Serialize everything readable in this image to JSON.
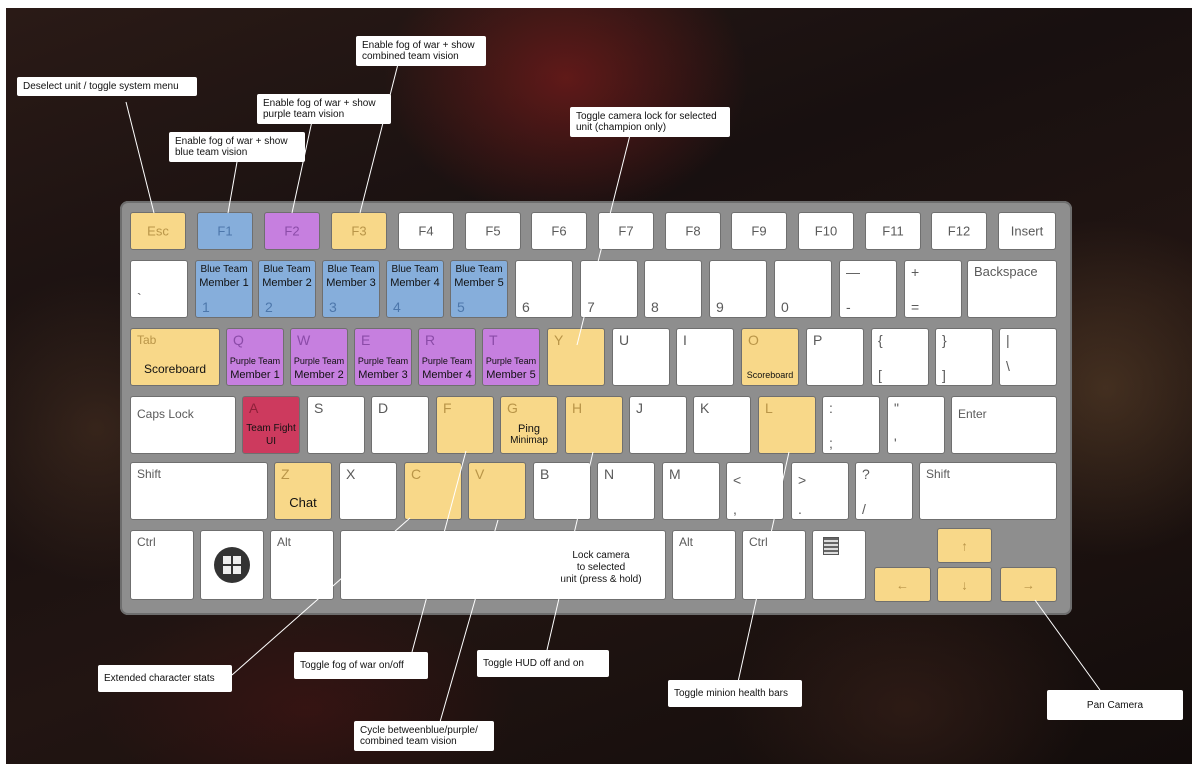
{
  "keys": {
    "esc": "Esc",
    "f1": "F1",
    "f2": "F2",
    "f3": "F3",
    "f4": "F4",
    "f5": "F5",
    "f6": "F6",
    "f7": "F7",
    "f8": "F8",
    "f9": "F9",
    "f10": "F10",
    "f11": "F11",
    "f12": "F12",
    "insert": "Insert",
    "backtick": "`",
    "n1": "1",
    "n2": "2",
    "n3": "3",
    "n4": "4",
    "n5": "5",
    "n6": "6",
    "n7": "7",
    "n8": "8",
    "n9": "9",
    "n0": "0",
    "minus_top": "—",
    "minus_bottom": "-",
    "plus_top": "+",
    "plus_bottom": "=",
    "backspace": "Backspace",
    "tab": "Tab",
    "q": "Q",
    "w": "W",
    "e": "E",
    "r": "R",
    "t": "T",
    "y": "Y",
    "u": "U",
    "i": "I",
    "o": "O",
    "p": "P",
    "brace_open_top": "{",
    "brace_open_bottom": "[",
    "brace_close_top": "}",
    "brace_close_bottom": "]",
    "pipe_top": "|",
    "pipe_bottom": "\\",
    "caps": "Caps Lock",
    "a": "A",
    "s": "S",
    "d": "D",
    "f": "F",
    "g": "G",
    "h": "H",
    "j": "J",
    "k": "K",
    "l": "L",
    "colon_top": ":",
    "colon_bottom": ";",
    "quote_top": "\"",
    "quote_bottom": "'",
    "enter": "Enter",
    "shift_left": "Shift",
    "z": "Z",
    "x": "X",
    "c": "C",
    "v": "V",
    "b": "B",
    "n": "N",
    "m": "M",
    "lt_top": "<",
    "lt_bottom": ",",
    "gt_top": ">",
    "gt_bottom": ".",
    "q_top": "?",
    "q_bottom": "/",
    "shift_right": "Shift",
    "ctrl_left": "Ctrl",
    "alt_left": "Alt",
    "alt_right": "Alt",
    "ctrl_right": "Ctrl",
    "up": "↑",
    "left": "←",
    "down": "↓",
    "right": "→"
  },
  "actions": {
    "blue1": [
      "Blue Team",
      "Member 1"
    ],
    "blue2": [
      "Blue Team",
      "Member 2"
    ],
    "blue3": [
      "Blue Team",
      "Member 3"
    ],
    "blue4": [
      "Blue Team",
      "Member 4"
    ],
    "blue5": [
      "Blue Team",
      "Member 5"
    ],
    "tab": "Scoreboard",
    "purple1": [
      "Purple Team",
      "Member 1"
    ],
    "purple2": [
      "Purple Team",
      "Member 2"
    ],
    "purple3": [
      "Purple Team",
      "Member 3"
    ],
    "purple4": [
      "Purple Team",
      "Member 4"
    ],
    "purple5": [
      "Purple Team",
      "Member 5"
    ],
    "o": "Scoreboard",
    "a": [
      "Team Fight",
      "UI"
    ],
    "g": [
      "Ping",
      "Minimap"
    ],
    "z": "Chat",
    "space": [
      "Lock camera",
      "to selected",
      "unit (press & hold)"
    ]
  },
  "callouts": {
    "esc": "Deselect unit / toggle system menu",
    "f1": "Enable fog of war + show blue team vision",
    "f2": "Enable fog of war + show purple team vision",
    "f3": "Enable fog of war + show combined team vision",
    "y": "Toggle camera lock for selected unit (champion only)",
    "c": "Extended character stats",
    "f": "Toggle fog of war on/off",
    "v": "Cycle betweenblue/purple/ combined team vision",
    "h": "Toggle HUD off and on",
    "l": "Toggle minion health bars",
    "arrows": "Pan Camera"
  },
  "colors": {
    "yellow": "#f8d889",
    "blue": "#86aedb",
    "purple": "#c67fdf",
    "red": "#cd3a5e",
    "keyboard": "#8e8e8e"
  }
}
